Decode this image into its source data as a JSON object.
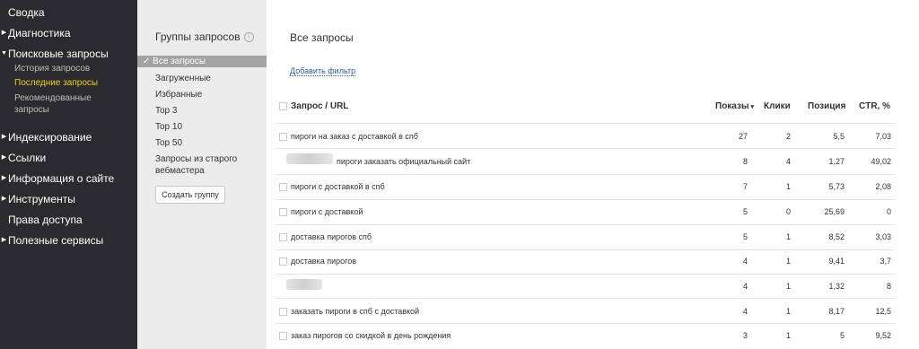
{
  "sidebar": {
    "items": [
      {
        "label": "Сводка"
      },
      {
        "label": "Диагностика"
      },
      {
        "label": "Поисковые запросы"
      },
      {
        "label": "Индексирование"
      },
      {
        "label": "Ссылки"
      },
      {
        "label": "Информация о сайте"
      },
      {
        "label": "Инструменты"
      },
      {
        "label": "Права доступа"
      },
      {
        "label": "Полезные сервисы"
      }
    ],
    "subitems": [
      {
        "label": "История запросов"
      },
      {
        "label": "Последние запросы"
      },
      {
        "label": "Рекомендованные запросы"
      }
    ]
  },
  "groups": {
    "title": "Группы запросов",
    "items": [
      {
        "label": "✓ Все запросы"
      },
      {
        "label": "Загруженные"
      },
      {
        "label": "Избранные"
      },
      {
        "label": "Top 3"
      },
      {
        "label": "Top 10"
      },
      {
        "label": "Top 50"
      },
      {
        "label": "Запросы из старого вебмастера"
      }
    ],
    "create_button": "Создать группу"
  },
  "main": {
    "title": "Все запросы",
    "add_filter": "Добавить фильтр",
    "columns": {
      "query": "Запрос / URL",
      "shows": "Показы",
      "clicks": "Клики",
      "position": "Позиция",
      "ctr": "CTR, %"
    },
    "rows": [
      {
        "query": "пироги на заказ с доставкой в спб",
        "shows": "27",
        "clicks": "2",
        "position": "5,5",
        "ctr": "7,03"
      },
      {
        "query": "пироги заказать официальный сайт",
        "shows": "8",
        "clicks": "4",
        "position": "1,27",
        "ctr": "49,02"
      },
      {
        "query": "пироги с доставкой в спб",
        "shows": "7",
        "clicks": "1",
        "position": "5,73",
        "ctr": "2,08"
      },
      {
        "query": "пироги с доставкой",
        "shows": "5",
        "clicks": "0",
        "position": "25,69",
        "ctr": "0"
      },
      {
        "query": "доставка пирогов спб",
        "shows": "5",
        "clicks": "1",
        "position": "8,52",
        "ctr": "3,03"
      },
      {
        "query": "доставка пирогов",
        "shows": "4",
        "clicks": "1",
        "position": "9,41",
        "ctr": "3,7"
      },
      {
        "query": "",
        "shows": "4",
        "clicks": "1",
        "position": "1,32",
        "ctr": "8"
      },
      {
        "query": "заказать пироги в спб с доставкой",
        "shows": "4",
        "clicks": "1",
        "position": "8,17",
        "ctr": "12,5"
      },
      {
        "query": "заказ пирогов со скидкой в день рождения",
        "shows": "3",
        "clicks": "1",
        "position": "5",
        "ctr": "9,52"
      }
    ]
  },
  "colors": {
    "sidebar_bg": "#2b2b2f",
    "active_link": "#f2cd1f",
    "link": "#2f5ba0"
  },
  "icons": {
    "expand": "triangle-right-icon",
    "info": "info-icon",
    "checkbox": "checkbox-icon",
    "sort": "sort-down-icon"
  }
}
